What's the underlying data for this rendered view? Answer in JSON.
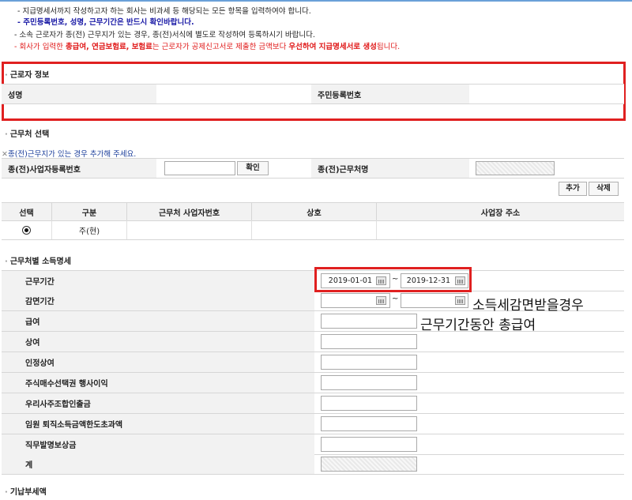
{
  "notes": {
    "line1": "- 지급명세서까지 작성하고자 하는 회사는 비과세 등 해당되는 모든 항목을 입력하여야 합니다.",
    "line2": "- 주민등록번호, 성명, 근무기간은 반드시 확인바랍니다.",
    "line3": "- 소속 근로자가 종(전) 근무지가 있는 경우, 종(전)서식에 별도로 작성하여 등록하시기 바랍니다.",
    "line4_prefix": "- 회사가 입력한 ",
    "line4_bold": "총급여, 연금보험료, 보험료",
    "line4_mid": "는 근로자가 공제신고서로 제출한 금액보다 ",
    "line4_bold2": "우선하여 지급명세서로 생성",
    "line4_suffix": "됩니다."
  },
  "worker_info": {
    "title": "근로자 정보",
    "name_label": "성명",
    "id_label": "주민등록번호"
  },
  "workplace_select": {
    "title": "근무처 선택",
    "hint": "종(전)근무지가 있는 경우 추가해 주세요.",
    "prev_biz_label": "종(전)사업자등록번호",
    "confirm_button": "확인",
    "prev_name_label": "종(전)근무처명",
    "add_button": "추가",
    "delete_button": "삭제",
    "columns": [
      "선택",
      "구분",
      "근무처 사업자번호",
      "상호",
      "사업장 주소"
    ],
    "rows": [
      {
        "selected": true,
        "type": "주(현)",
        "biz_no": "",
        "name": "",
        "address": ""
      }
    ]
  },
  "income_detail": {
    "title": "근무처별 소득명세",
    "period_label": "근무기간",
    "period_start": "2019-01-01",
    "period_end": "2019-12-31",
    "period_sep": "~",
    "reduction_label": "감면기간",
    "reduction_start": "",
    "reduction_end": "",
    "reduction_sep": "~",
    "fields": [
      {
        "label": "급여",
        "value": ""
      },
      {
        "label": "상여",
        "value": ""
      },
      {
        "label": "인정상여",
        "value": ""
      },
      {
        "label": "주식매수선택권 행사이익",
        "value": ""
      },
      {
        "label": "우리사주조합인출금",
        "value": ""
      },
      {
        "label": "임원 퇴직소득금액한도초과액",
        "value": ""
      },
      {
        "label": "직무발명보상금",
        "value": ""
      }
    ],
    "total_label": "계"
  },
  "annotation": {
    "line1": "소득세감면받을경우",
    "line2": "근무기간동안 총급여"
  },
  "tax_section": {
    "title": "기납부세액"
  },
  "colors": {
    "highlight_red": "#e02020",
    "label_bg": "#f2f2f2"
  }
}
